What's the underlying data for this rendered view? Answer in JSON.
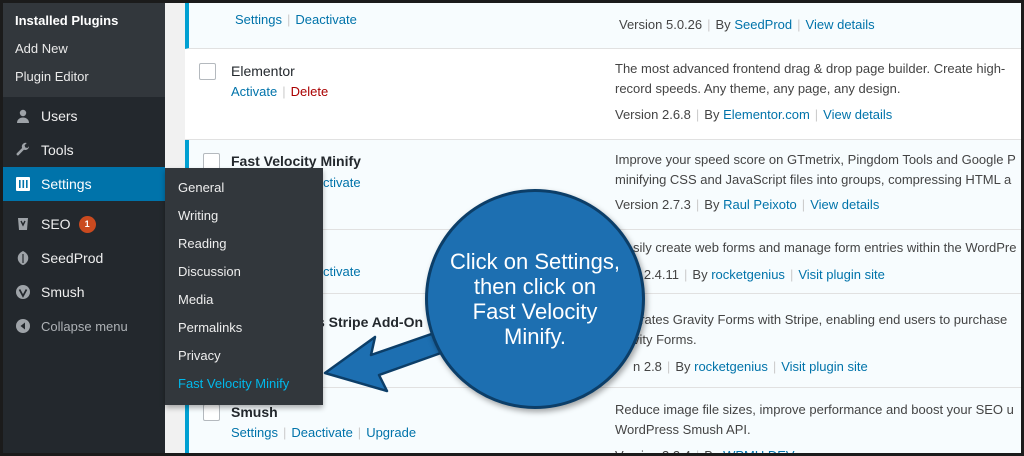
{
  "sidebar": {
    "submenu": [
      "Installed Plugins",
      "Add New",
      "Plugin Editor"
    ],
    "items": [
      {
        "label": "Users",
        "icon": "users-icon"
      },
      {
        "label": "Tools",
        "icon": "wrench-icon"
      },
      {
        "label": "Settings",
        "icon": "settings-icon"
      },
      {
        "label": "SEO",
        "icon": "yoast-icon",
        "badge": "1"
      },
      {
        "label": "SeedProd",
        "icon": "seedprod-icon"
      },
      {
        "label": "Smush",
        "icon": "smush-icon"
      },
      {
        "label": "Collapse menu",
        "icon": "collapse-icon"
      }
    ]
  },
  "flyout": {
    "items": [
      "General",
      "Writing",
      "Reading",
      "Discussion",
      "Media",
      "Permalinks",
      "Privacy",
      "Fast Velocity Minify"
    ]
  },
  "plugins": [
    {
      "name": "",
      "actions": [
        "Settings",
        "Deactivate"
      ],
      "description": [],
      "version": "Version 5.0.26",
      "by": "SeedProd",
      "link": "View details"
    },
    {
      "name": "Elementor",
      "actions": [
        "Activate",
        "Delete"
      ],
      "description": [
        "The most advanced frontend drag & drop page builder. Create high-",
        "record speeds. Any theme, any page, any design."
      ],
      "version": "Version 2.6.8",
      "by": "Elementor.com",
      "link": "View details"
    },
    {
      "name": "Fast Velocity Minify",
      "actions": [
        "ctivate"
      ],
      "description": [
        "Improve your speed score on GTmetrix, Pingdom Tools and Google P",
        "minifying CSS and JavaScript files into groups, compressing HTML a"
      ],
      "version": "Version 2.7.3",
      "by": "Raul Peixoto",
      "link": "View details"
    },
    {
      "name": "s",
      "actions": [
        "ctivate"
      ],
      "description": [
        "sily create web forms and manage form entries within the WordPre"
      ],
      "version": "n 2.4.11",
      "by": "rocketgenius",
      "link": "Visit plugin site"
    },
    {
      "name": "s Stripe Add-On",
      "actions": [],
      "description": [
        "grates Gravity Forms with Stripe, enabling end users to purchase",
        "vity Forms."
      ],
      "version": "n 2.8",
      "by": "rocketgenius",
      "link": "Visit plugin site"
    },
    {
      "name": "Smush",
      "actions": [
        "Settings",
        "Deactivate",
        "Upgrade"
      ],
      "description": [
        "Reduce image file sizes, improve performance and boost your SEO u",
        "WordPress Smush API."
      ],
      "version": "Version 3.2.4",
      "by": "WPMU DEV",
      "link": ""
    }
  ],
  "by_prefix": "By",
  "callout": {
    "text": "Click on Settings, then click on Fast Velocity Minify."
  },
  "colors": {
    "sidebar_bg": "#23282d",
    "accent": "#0073aa",
    "callout": "#1d6fb1",
    "link": "#0073aa"
  }
}
